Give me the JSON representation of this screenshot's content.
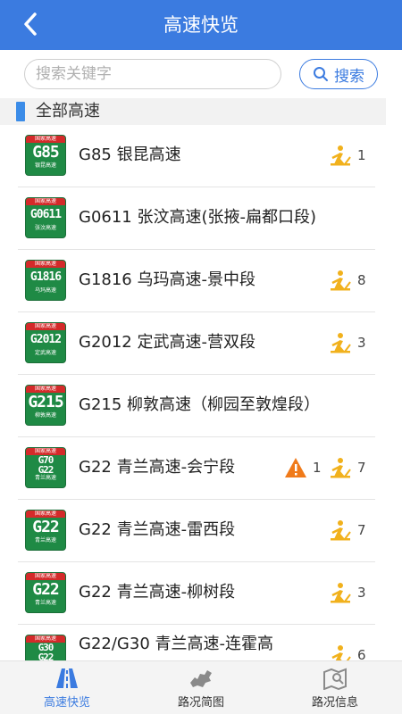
{
  "header": {
    "title": "高速快览"
  },
  "search": {
    "placeholder": "搜索关键字",
    "button_label": "搜索"
  },
  "section": {
    "label": "全部高速"
  },
  "rows": [
    {
      "code": "G85",
      "badge_top": "国家高速",
      "badge_sub": "银昆高速",
      "name": "G85 银昆高速",
      "warn": null,
      "work": "1"
    },
    {
      "code": "G0611",
      "badge_top": "国家高速",
      "badge_sub": "张汶高速",
      "name": "G0611 张汶高速(张掖-扁都口段)",
      "warn": null,
      "work": null
    },
    {
      "code": "G1816",
      "badge_top": "国家高速",
      "badge_sub": "乌玛高速",
      "name": "G1816 乌玛高速-景中段",
      "warn": null,
      "work": "8"
    },
    {
      "code": "G2012",
      "badge_top": "国家高速",
      "badge_sub": "定武高速",
      "name": "G2012 定武高速-营双段",
      "warn": null,
      "work": "3"
    },
    {
      "code": "G215",
      "badge_top": "国家高速",
      "badge_sub": "柳敦高速",
      "name": "G215 柳敦高速（柳园至敦煌段）",
      "warn": null,
      "work": null
    },
    {
      "code": "G70 G22",
      "badge_top": "国家高速",
      "badge_sub": "青兰高速",
      "name": "G22 青兰高速-会宁段",
      "warn": "1",
      "work": "7"
    },
    {
      "code": "G22",
      "badge_top": "国家高速",
      "badge_sub": "青兰高速",
      "name": "G22 青兰高速-雷西段",
      "warn": null,
      "work": "7"
    },
    {
      "code": "G22",
      "badge_top": "国家高速",
      "badge_sub": "青兰高速",
      "name": "G22 青兰高速-柳树段",
      "warn": null,
      "work": "3"
    },
    {
      "code": "G30 G22",
      "badge_top": "国家高速",
      "badge_sub": "",
      "name": "G22/G30 青兰高速-连霍高",
      "warn": null,
      "work": "6"
    }
  ],
  "nav": [
    {
      "label": "高速快览",
      "icon": "road-icon",
      "active": true
    },
    {
      "label": "路况简图",
      "icon": "map-outline-icon",
      "active": false
    },
    {
      "label": "路况信息",
      "icon": "map-info-icon",
      "active": false
    }
  ],
  "colors": {
    "header": "#3b7be0",
    "badge_green": "#1f8a45",
    "work_yellow": "#f1b11c",
    "warn_orange": "#f07a1a"
  }
}
